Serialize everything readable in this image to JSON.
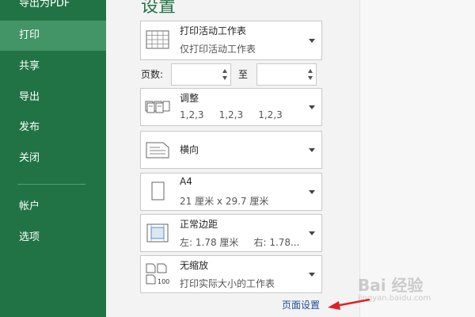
{
  "sidebar": {
    "items": [
      {
        "label": "导出为PDF",
        "active": false
      },
      {
        "label": "打印",
        "active": true
      },
      {
        "label": "共享",
        "active": false
      },
      {
        "label": "导出",
        "active": false
      },
      {
        "label": "发布",
        "active": false
      },
      {
        "label": "关闭",
        "active": false
      },
      {
        "label": "帐户",
        "active": false
      },
      {
        "label": "选项",
        "active": false
      }
    ]
  },
  "settings": {
    "heading": "设置",
    "print_what": {
      "title": "打印活动工作表",
      "subtitle": "仅打印活动工作表"
    },
    "pages": {
      "label": "页数:",
      "from_value": "",
      "to_label": "至",
      "to_value": ""
    },
    "collate": {
      "title": "调整",
      "subtitle": "1,2,3     1,2,3     1,2,3"
    },
    "orientation": {
      "title": "横向"
    },
    "paper": {
      "title": "A4",
      "subtitle": "21 厘米 x 29.7 厘米"
    },
    "margins": {
      "title": "正常边距",
      "subtitle": "左: 1.78 厘米     右: 1.78..."
    },
    "scaling": {
      "title": "无缩放",
      "subtitle": "打印实际大小的工作表"
    },
    "page_setup_link": "页面设置"
  },
  "watermark": {
    "brand": "Bai 经验",
    "url": "jingyan.baidu.com"
  },
  "colors": {
    "sidebar": "#217346",
    "active": "#439467",
    "arrow": "#e02020",
    "link": "#1f4e99"
  }
}
